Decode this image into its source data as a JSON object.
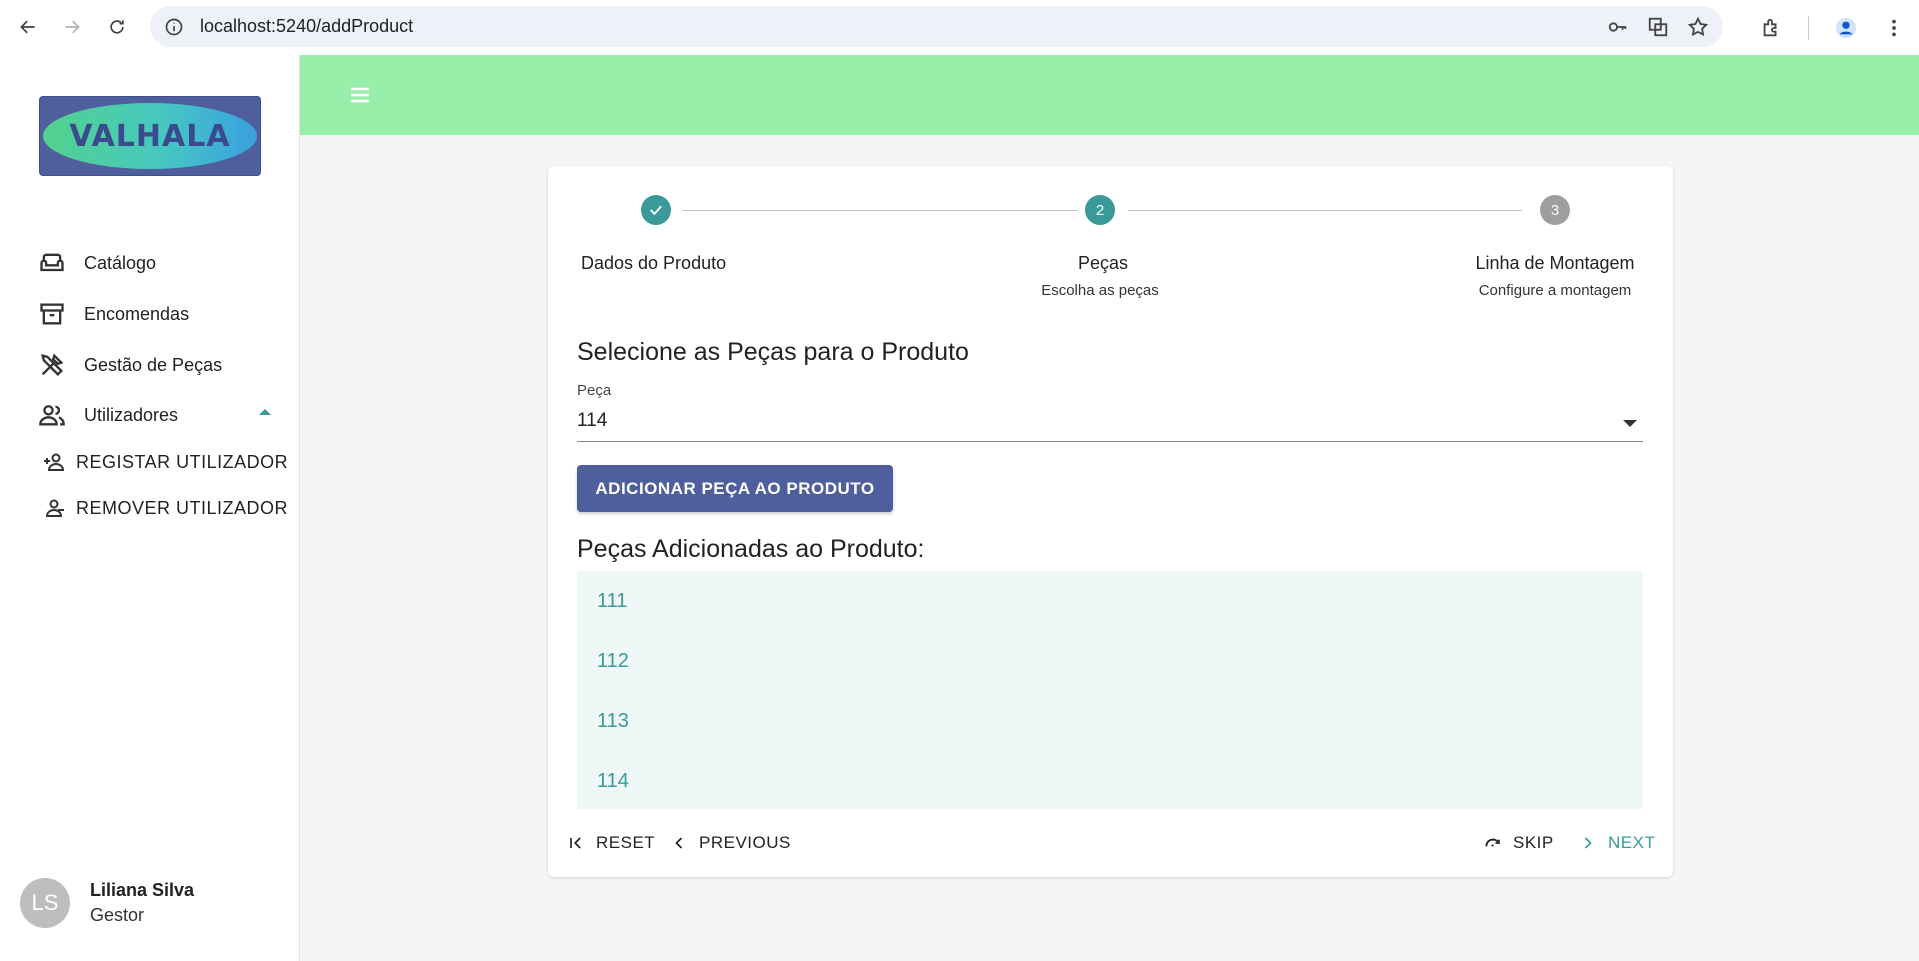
{
  "browser": {
    "url": "localhost:5240/addProduct"
  },
  "sidebar": {
    "logo_text": "VALHALA",
    "items": [
      {
        "label": "Catálogo",
        "icon": "sofa-icon"
      },
      {
        "label": "Encomendas",
        "icon": "archive-icon"
      },
      {
        "label": "Gestão de Peças",
        "icon": "tools-icon"
      },
      {
        "label": "Utilizadores",
        "icon": "people-icon"
      }
    ],
    "subitems": [
      {
        "label": "REGISTAR UTILIZADOR",
        "icon": "person-add-icon"
      },
      {
        "label": "REMOVER UTILIZADOR",
        "icon": "person-remove-icon"
      }
    ],
    "user": {
      "initials": "LS",
      "name": "Liliana Silva",
      "role": "Gestor"
    }
  },
  "stepper": {
    "steps": [
      {
        "number": "1",
        "label": "Dados do Produto",
        "sublabel": "",
        "status": "completed"
      },
      {
        "number": "2",
        "label": "Peças",
        "sublabel": "Escolha as peças",
        "status": "active"
      },
      {
        "number": "3",
        "label": "Linha de Montagem",
        "sublabel": "Configure a montagem",
        "status": "pending"
      }
    ]
  },
  "form": {
    "title": "Selecione as Peças para o Produto",
    "field_label": "Peça",
    "selected_value": "114",
    "add_button": "ADICIONAR PEÇA AO PRODUTO",
    "list_title": "Peças Adicionadas ao Produto:",
    "added_parts": [
      "111",
      "112",
      "113",
      "114"
    ]
  },
  "footer": {
    "reset": "RESET",
    "previous": "PREVIOUS",
    "skip": "SKIP",
    "next": "NEXT"
  },
  "colors": {
    "accent": "#3a9a9a",
    "app_bar": "#98efaa",
    "primary_button": "#4f5f9e",
    "list_background": "#eef8f6",
    "pending_step": "#9e9e9e"
  }
}
